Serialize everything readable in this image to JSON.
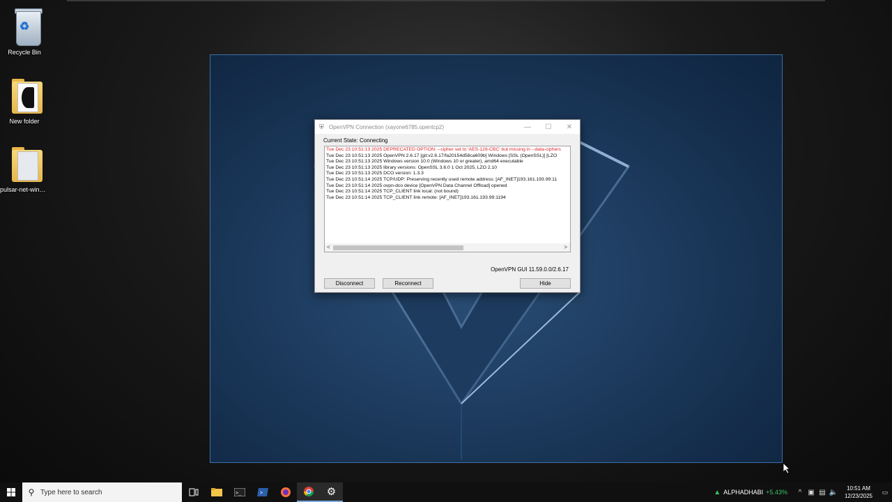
{
  "desktop": {
    "icons": [
      {
        "label": "Recycle Bin"
      },
      {
        "label": "New folder"
      },
      {
        "label": "pulsar-net-win64..."
      }
    ]
  },
  "vpn_window": {
    "title": "OpenVPN Connection (xayone6785.opentcp2)",
    "current_state": "Current State: Connecting",
    "log": [
      {
        "text": "Tue Dec 23 10:51:13 2025 DEPRECATED OPTION: --cipher set to 'AES-128-CBC' but missing in --data-ciphers",
        "warn": true
      },
      {
        "text": "Tue Dec 23 10:51:13 2025 OpenVPN 2.6.17 [git:v2.6.17/fa20154d58ca609b] Windows [SSL (OpenSSL)] [LZO",
        "warn": false
      },
      {
        "text": "Tue Dec 23 10:51:13 2025 Windows version 10.0 (Windows 10 or greater), amd64 executable",
        "warn": false
      },
      {
        "text": "Tue Dec 23 10:51:13 2025 library versions: OpenSSL 3.6.0 1 Oct 2025, LZO 2.10",
        "warn": false
      },
      {
        "text": "Tue Dec 23 10:51:13 2025 DCO version: 1.3.3",
        "warn": false
      },
      {
        "text": "Tue Dec 23 10:51:14 2025 TCP/UDP: Preserving recently used remote address: [AF_INET]193.161.193.99:11",
        "warn": false
      },
      {
        "text": "Tue Dec 23 10:51:14 2025 ovpn-dco device [OpenVPN Data Channel Offload] opened",
        "warn": false
      },
      {
        "text": "Tue Dec 23 10:51:14 2025 TCP_CLIENT link local: (not bound)",
        "warn": false
      },
      {
        "text": "Tue Dec 23 10:51:14 2025 TCP_CLIENT link remote: [AF_INET]193.161.193.99:1194",
        "warn": false
      }
    ],
    "version": "OpenVPN GUI 11.59.0.0/2.6.17",
    "buttons": {
      "disconnect": "Disconnect",
      "reconnect": "Reconnect",
      "hide": "Hide"
    }
  },
  "taskbar": {
    "search_placeholder": "Type here to search",
    "apps": [
      {
        "icon": "task-view-icon"
      },
      {
        "icon": "file-explorer-icon"
      },
      {
        "icon": "terminal-icon"
      },
      {
        "icon": "powershell-icon"
      },
      {
        "icon": "firefox-icon"
      },
      {
        "icon": "chrome-icon"
      },
      {
        "icon": "settings-icon"
      }
    ],
    "stock": {
      "name": "ALPHADHABI",
      "change": "+5.43%"
    },
    "clock": {
      "time": "10:51 AM",
      "date": "12/23/2025"
    }
  },
  "colors": {
    "warn": "#d9232e",
    "taskbar": "#101010",
    "accent": "#7aa8e0",
    "stock_up": "#3cc26a"
  }
}
